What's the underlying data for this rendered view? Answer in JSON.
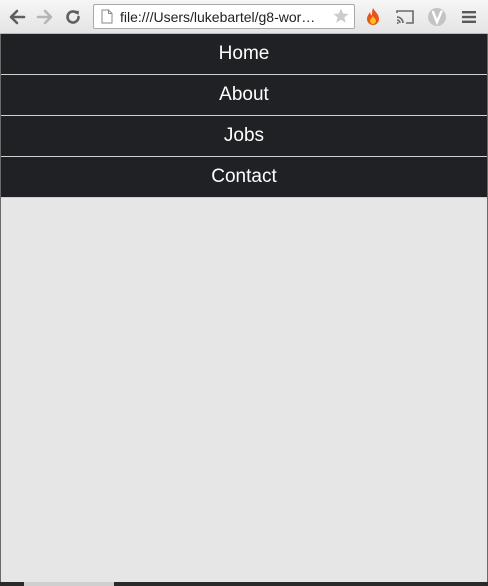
{
  "browser": {
    "url": "file:///Users/lukebartel/g8-wor…",
    "icons": {
      "back": "back-arrow-icon",
      "forward": "forward-arrow-icon",
      "reload": "reload-icon",
      "page": "page-icon",
      "bookmark": "star-icon",
      "extension_fire": "fire-extension-icon",
      "cast": "cast-icon",
      "extension_v": "v-extension-icon",
      "menu": "menu-icon"
    },
    "colors": {
      "toolbar": "#ececec",
      "star": "#c8c8c8",
      "fire": "#f39c12"
    }
  },
  "page": {
    "background": "#e6e6e6",
    "nav": {
      "background": "#202125",
      "text_color": "#ffffff",
      "items": [
        {
          "label": "Home"
        },
        {
          "label": "About"
        },
        {
          "label": "Jobs"
        },
        {
          "label": "Contact"
        }
      ]
    }
  }
}
